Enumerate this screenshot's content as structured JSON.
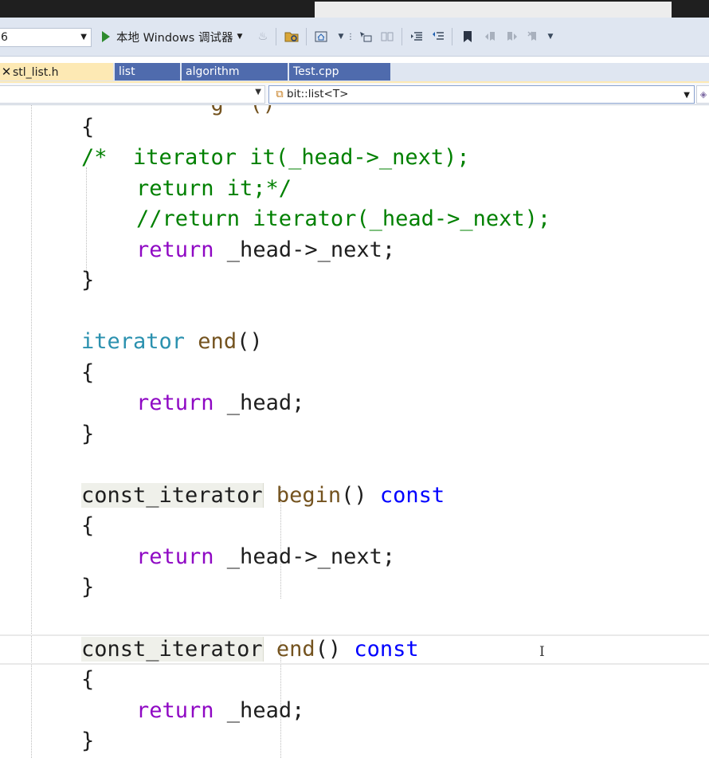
{
  "toolbar": {
    "config_value": "6",
    "debugger_label": "本地 Windows 调试器"
  },
  "tabs": [
    {
      "label": "stl_list.h",
      "active": true
    },
    {
      "label": "list",
      "active": false
    },
    {
      "label": "algorithm",
      "active": false
    },
    {
      "label": "Test.cpp",
      "active": false
    }
  ],
  "navbar": {
    "scope_value": "bit::list<T>"
  },
  "code": {
    "open_brace": "{",
    "close_brace": "}",
    "comment_line1": "/*  iterator it(_head->_next);",
    "comment_line2": "return it;*/",
    "comment_line3": "//return iterator(_head->_next);",
    "kw_return": "return",
    "ret_head_next": " _head->_next;",
    "ret_head": " _head;",
    "type_iterator": "iterator",
    "type_const_iterator": "const_iterator",
    "fn_end": " end",
    "fn_begin": " begin",
    "parens": "()",
    "kw_const": " const"
  },
  "colors": {
    "type": "#2b91af",
    "keyword": "#0000ff",
    "control_keyword": "#8f08c4",
    "function": "#74531f",
    "comment": "#008000",
    "tab_active_bg": "#fde9b4",
    "tab_inactive_bg": "#4f6bad"
  }
}
